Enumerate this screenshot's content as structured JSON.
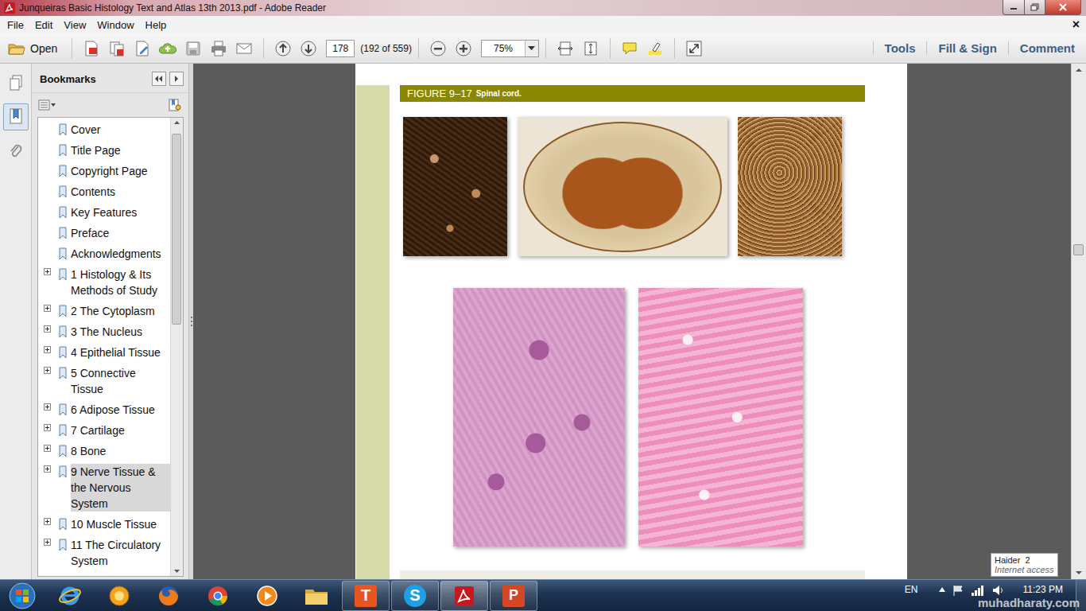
{
  "window": {
    "title": "Junqueiras Basic Histology Text and Atlas 13th 2013.pdf - Adobe Reader"
  },
  "menu": {
    "items": [
      "File",
      "Edit",
      "View",
      "Window",
      "Help"
    ],
    "close": "×"
  },
  "toolbar": {
    "open": "Open",
    "page": "178",
    "page_count": "(192 of 559)",
    "zoom": "75%",
    "panes": [
      "Tools",
      "Fill & Sign",
      "Comment"
    ]
  },
  "sidebar": {
    "title": "Bookmarks",
    "scroll": {
      "level": 0.02
    },
    "items": [
      {
        "label": "Cover",
        "expandable": false,
        "selected": false
      },
      {
        "label": "Title Page",
        "expandable": false,
        "selected": false
      },
      {
        "label": "Copyright Page",
        "expandable": false,
        "selected": false
      },
      {
        "label": "Contents",
        "expandable": false,
        "selected": false
      },
      {
        "label": "Key Features",
        "expandable": false,
        "selected": false
      },
      {
        "label": "Preface",
        "expandable": false,
        "selected": false
      },
      {
        "label": "Acknowledgments",
        "expandable": false,
        "selected": false
      },
      {
        "label": "1 Histology & Its Methods of Study",
        "expandable": true,
        "selected": false
      },
      {
        "label": "2 The Cytoplasm",
        "expandable": true,
        "selected": false
      },
      {
        "label": "3 The Nucleus",
        "expandable": true,
        "selected": false
      },
      {
        "label": "4 Epithelial Tissue",
        "expandable": true,
        "selected": false
      },
      {
        "label": "5 Connective Tissue",
        "expandable": true,
        "selected": false
      },
      {
        "label": "6 Adipose Tissue",
        "expandable": true,
        "selected": false
      },
      {
        "label": "7 Cartilage",
        "expandable": true,
        "selected": false
      },
      {
        "label": "8 Bone",
        "expandable": true,
        "selected": false
      },
      {
        "label": "9 Nerve Tissue & the Nervous System",
        "expandable": true,
        "selected": true
      },
      {
        "label": "10 Muscle Tissue",
        "expandable": true,
        "selected": false
      },
      {
        "label": "11 The Circulatory System",
        "expandable": true,
        "selected": false
      }
    ]
  },
  "document": {
    "figure_label": "FIGURE 9–17",
    "figure_title": "Spinal cord.",
    "scroll": {
      "level": 0.35
    }
  },
  "network_popup": {
    "name": "Haider  2",
    "status": "Internet access"
  },
  "taskbar": {
    "apps": [
      {
        "kind": "start",
        "running": false,
        "active": false
      },
      {
        "kind": "ie",
        "running": false,
        "active": false
      },
      {
        "kind": "messenger",
        "running": false,
        "active": false
      },
      {
        "kind": "firefox",
        "running": false,
        "active": false
      },
      {
        "kind": "chrome",
        "running": false,
        "active": false
      },
      {
        "kind": "media",
        "running": false,
        "active": false
      },
      {
        "kind": "explorer",
        "running": false,
        "active": false
      },
      {
        "kind": "tile",
        "glyph": "T",
        "running": true,
        "active": false
      },
      {
        "kind": "skype",
        "glyph": "S",
        "running": true,
        "active": false
      },
      {
        "kind": "acrobat",
        "running": true,
        "active": true
      },
      {
        "kind": "powerpoint",
        "glyph": "P",
        "running": true,
        "active": false
      }
    ],
    "language": "EN",
    "clock": "11:23 PM"
  },
  "watermark": "muhadharaty.com"
}
